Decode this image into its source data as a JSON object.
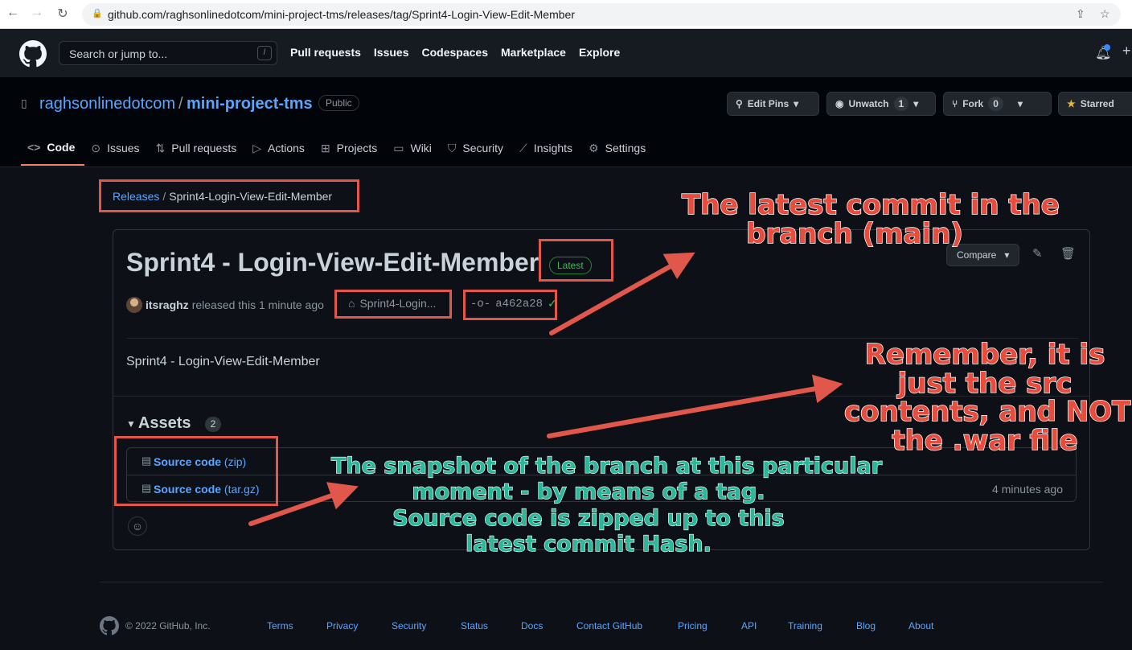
{
  "browser": {
    "url": "github.com/raghsonlinedotcom/mini-project-tms/releases/tag/Sprint4-Login-View-Edit-Member"
  },
  "header": {
    "search_placeholder": "Search or jump to...",
    "search_key": "/",
    "nav": [
      "Pull requests",
      "Issues",
      "Codespaces",
      "Marketplace",
      "Explore"
    ]
  },
  "repo": {
    "owner": "raghsonlinedotcom",
    "separator": "/",
    "name": "mini-project-tms",
    "visibility": "Public",
    "edit_pins": "Edit Pins",
    "unwatch": "Unwatch",
    "watch_count": "1",
    "fork": "Fork",
    "fork_count": "0",
    "starred": "Starred",
    "tabs": [
      "Code",
      "Issues",
      "Pull requests",
      "Actions",
      "Projects",
      "Wiki",
      "Security",
      "Insights",
      "Settings"
    ]
  },
  "breadcrumb": {
    "root": "Releases",
    "separator": "/",
    "current": "Sprint4-Login-View-Edit-Member"
  },
  "release": {
    "title": "Sprint4 - Login-View-Edit-Member",
    "badge": "Latest",
    "compare": "Compare",
    "author": "itsraghz",
    "released_text": "released this 1 minute ago",
    "tag": "Sprint4-Login...",
    "commit": "a462a28",
    "body": "Sprint4 - Login-View-Edit-Member",
    "assets_label": "Assets",
    "assets_count": "2",
    "assets": [
      {
        "name": "Source code",
        "ext": "(zip)",
        "time": ""
      },
      {
        "name": "Source code",
        "ext": "(tar.gz)",
        "time": "4 minutes ago"
      }
    ]
  },
  "footer": {
    "copyright": "© 2022 GitHub, Inc.",
    "links": [
      "Terms",
      "Privacy",
      "Security",
      "Status",
      "Docs",
      "Contact GitHub",
      "Pricing",
      "API",
      "Training",
      "Blog",
      "About"
    ]
  },
  "annotations": {
    "commit_note": [
      "The latest commit in the",
      "branch (main)"
    ],
    "src_note": [
      "Remember, it is",
      "just the src",
      "contents, and NOT",
      "the .war file"
    ],
    "snapshot_note": [
      "The snapshot of the branch at this particular",
      "moment - by means of a tag.",
      "Source code is zipped up to this",
      "latest commit Hash."
    ],
    "colors": {
      "red": "#e74c3c",
      "green": "#2ab79a",
      "box": "#e2574c"
    }
  }
}
